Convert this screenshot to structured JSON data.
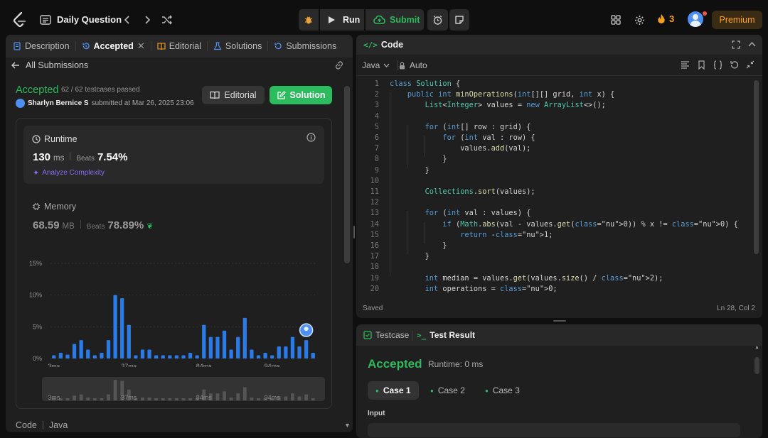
{
  "topbar": {
    "title": "Daily Question",
    "run_label": "Run",
    "submit_label": "Submit",
    "streak_count": "3",
    "premium_label": "Premium"
  },
  "left_tabs": [
    "Description",
    "Accepted",
    "Editorial",
    "Solutions",
    "Submissions"
  ],
  "submission": {
    "back_label": "All Submissions",
    "status": "Accepted",
    "testcases": "62 / 62 testcases passed",
    "user": "Sharlyn Bernice S",
    "submitted_text": "submitted at Mar 26, 2025 23:06",
    "editorial_btn": "Editorial",
    "solution_btn": "Solution"
  },
  "runtime": {
    "label": "Runtime",
    "value": "130",
    "unit": "ms",
    "beats_label": "Beats",
    "beats": "7.54%",
    "analyze": "Analyze Complexity"
  },
  "memory": {
    "label": "Memory",
    "value": "68.59",
    "unit": "MB",
    "beats_label": "Beats",
    "beats": "78.89%"
  },
  "chart_data": {
    "type": "bar",
    "y_ticks": [
      "15%",
      "10%",
      "5%",
      "0%"
    ],
    "x_ticks": [
      "3ms",
      "37ms",
      "84ms",
      "94ms"
    ],
    "ylim": [
      0,
      15
    ],
    "values": [
      0.5,
      0.9,
      0.6,
      2.3,
      2.9,
      1.4,
      0.5,
      0.9,
      2.9,
      10.0,
      9.5,
      5.3,
      0.5,
      1.4,
      1.4,
      0.5,
      0.5,
      0.5,
      0.5,
      0.5,
      0.9,
      0.5,
      5.3,
      3.4,
      3.4,
      4.4,
      1.4,
      3.4,
      6.4,
      1.4,
      0.5,
      0.9,
      0.5,
      1.9,
      1.9,
      3.4,
      1.9,
      2.9,
      0.9
    ],
    "highlight_index": 37,
    "overview_x_ticks": [
      "3ms",
      "37ms",
      "84ms",
      "94ms"
    ]
  },
  "bottom_left": {
    "code_label": "Code",
    "lang": "Java"
  },
  "code_panel": {
    "title": "Code",
    "lang": "Java",
    "mode": "Auto",
    "status": "Saved",
    "cursor": "Ln 28, Col 2",
    "lines": [
      "class Solution {",
      "    public int minOperations(int[][] grid, int x) {",
      "        List<Integer> values = new ArrayList<>();",
      "",
      "        for (int[] row : grid) {",
      "            for (int val : row) {",
      "                values.add(val);",
      "            }",
      "        }",
      "",
      "        Collections.sort(values);",
      "",
      "        for (int val : values) {",
      "            if (Math.abs(val - values.get(0)) % x != 0) {",
      "                return -1;",
      "            }",
      "        }",
      "",
      "        int median = values.get(values.size() / 2);",
      "        int operations = 0;"
    ]
  },
  "test_panel": {
    "tab_testcase": "Testcase",
    "tab_result": "Test Result",
    "status": "Accepted",
    "runtime": "Runtime: 0 ms",
    "cases": [
      "Case 1",
      "Case 2",
      "Case 3"
    ],
    "input_label": "Input"
  }
}
